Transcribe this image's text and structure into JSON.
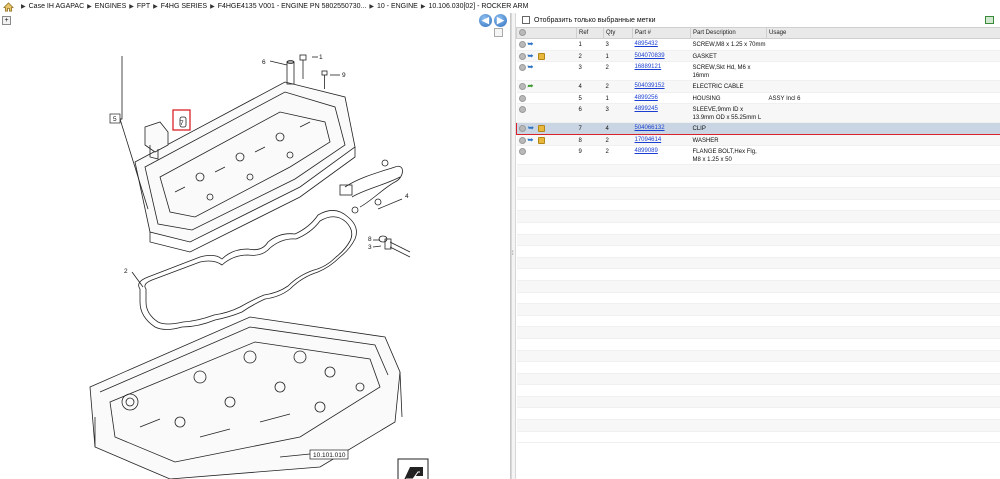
{
  "breadcrumb": {
    "home_icon": "home-icon",
    "items": [
      "Case IH AGAPAC",
      "ENGINES",
      "FPT",
      "F4HG SERIES",
      "F4HGE4135 V001 - ENGINE PN 5802550730...",
      "10 - ENGINE",
      "10.106.030[02] - ROCKER ARM"
    ]
  },
  "left": {
    "expand_icon": "+",
    "prev_icon": "◀",
    "next_icon": "▶"
  },
  "diagram": {
    "callouts": [
      "1",
      "2",
      "3",
      "4",
      "5",
      "6",
      "7",
      "8",
      "9"
    ],
    "ref_box": "10.101.010"
  },
  "right": {
    "filter_label": "Отобразить только выбранные метки",
    "headers": [
      "",
      "Ref",
      "Qty",
      "Part #",
      "Part Description",
      "Usage"
    ],
    "rows": [
      {
        "ref": "1",
        "qty": "3",
        "part": "4895432",
        "desc": "SCREW,M8 x 1.25 x 70mm",
        "usage": "",
        "icons": [
          "circle",
          "arrow"
        ]
      },
      {
        "ref": "2",
        "qty": "1",
        "part": "504070839",
        "desc": "GASKET",
        "usage": "",
        "icons": [
          "circle",
          "arrow",
          "box"
        ]
      },
      {
        "ref": "3",
        "qty": "2",
        "part": "16889121",
        "desc": "SCREW,Skt Hd, M6 x 16mm",
        "usage": "",
        "icons": [
          "circle",
          "arrow"
        ]
      },
      {
        "ref": "4",
        "qty": "2",
        "part": "504039152",
        "desc": "ELECTRIC CABLE",
        "usage": "",
        "icons": [
          "circle",
          "green-arrow"
        ]
      },
      {
        "ref": "5",
        "qty": "1",
        "part": "4899256",
        "desc": "HOUSING",
        "usage": "ASSY Incl 6",
        "icons": [
          "circle"
        ]
      },
      {
        "ref": "6",
        "qty": "3",
        "part": "4899245",
        "desc": "SLEEVE,9mm ID x 13.9mm OD x 55.25mm L",
        "usage": "",
        "icons": [
          "circle"
        ]
      },
      {
        "ref": "7",
        "qty": "4",
        "part": "504066132",
        "desc": "CLIP",
        "usage": "",
        "icons": [
          "circle",
          "arrow",
          "box"
        ],
        "selected": true
      },
      {
        "ref": "8",
        "qty": "2",
        "part": "17094614",
        "desc": "WASHER",
        "usage": "",
        "icons": [
          "circle",
          "arrow",
          "box"
        ]
      },
      {
        "ref": "9",
        "qty": "2",
        "part": "4899089",
        "desc": "FLANGE BOLT,Hex Flg, M8 x 1.25 x 50",
        "usage": "",
        "icons": [
          "circle"
        ]
      }
    ]
  }
}
